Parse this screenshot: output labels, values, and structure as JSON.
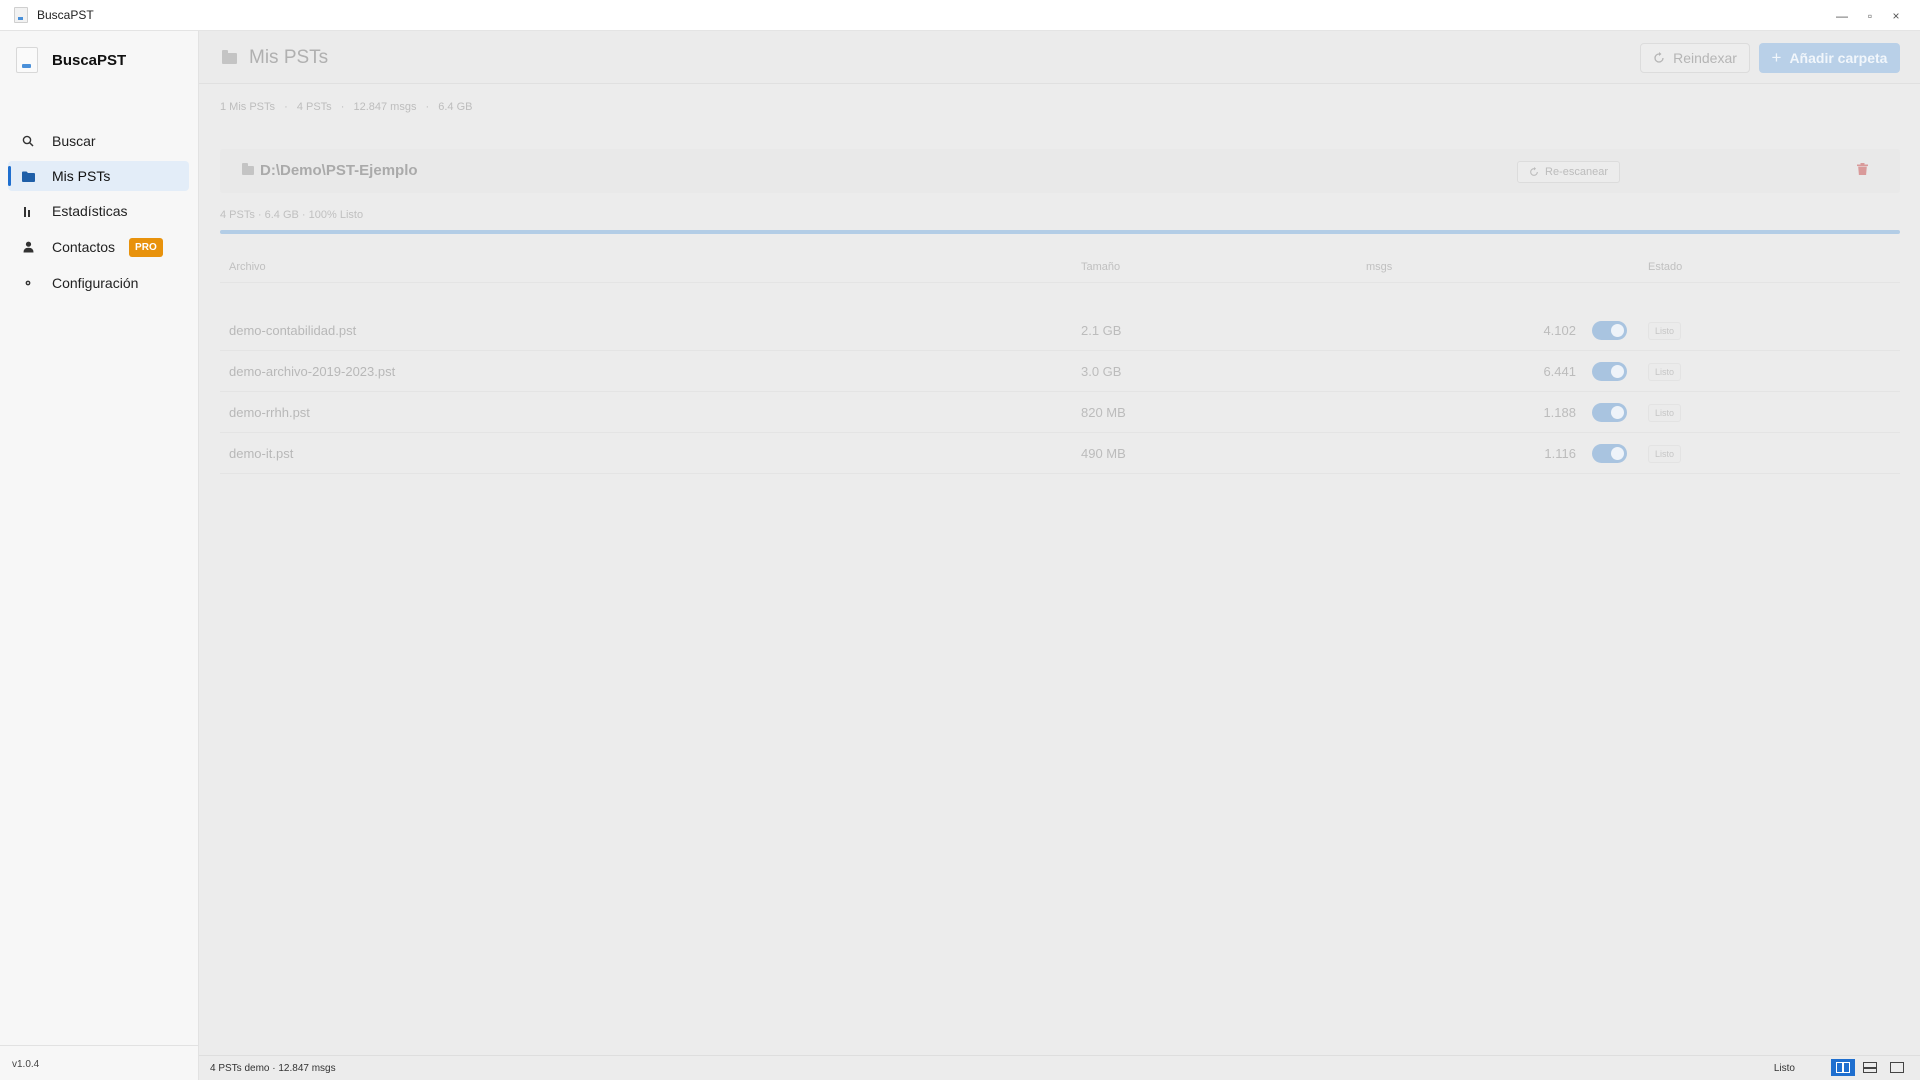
{
  "window": {
    "title": "BuscaPST",
    "controls": {
      "minimize": "—",
      "maximize": "▫",
      "close": "×"
    }
  },
  "sidebar": {
    "brand": "BuscaPST",
    "items": [
      {
        "label": "Buscar",
        "icon": "search-icon",
        "active": false
      },
      {
        "label": "Mis PSTs",
        "icon": "folder-icon",
        "active": true
      },
      {
        "label": "Estadísticas",
        "icon": "bar-chart-icon",
        "active": false
      },
      {
        "label": "Contactos",
        "icon": "person-icon",
        "active": false,
        "badge": "PRO"
      },
      {
        "label": "Configuración",
        "icon": "gear-icon",
        "active": false
      }
    ],
    "version": "v1.0.4"
  },
  "header": {
    "title": "Mis PSTs",
    "reindex_label": "Reindexar",
    "add_folder_label": "Añadir carpeta"
  },
  "summary": {
    "folders": "1 Mis PSTs",
    "psts": "4 PSTs",
    "msgs": "12.847 msgs",
    "size": "6.4 GB"
  },
  "folder": {
    "path": "D:\\Demo\\PST-Ejemplo",
    "rescan_label": "Re-escanear",
    "stats": "4 PSTs · 6.4 GB · 100% Listo",
    "progress": 1.0
  },
  "table": {
    "columns": {
      "file": "Archivo",
      "size": "Tamaño",
      "msgs": "msgs",
      "status": "Estado"
    },
    "rows": [
      {
        "file": "demo-contabilidad.pst",
        "size": "2.1 GB",
        "msgs": "4.102",
        "enabled": true,
        "status": "Listo"
      },
      {
        "file": "demo-archivo-2019-2023.pst",
        "size": "3.0 GB",
        "msgs": "6.441",
        "enabled": true,
        "status": "Listo"
      },
      {
        "file": "demo-rrhh.pst",
        "size": "820 MB",
        "msgs": "1.188",
        "enabled": true,
        "status": "Listo"
      },
      {
        "file": "demo-it.pst",
        "size": "490 MB",
        "msgs": "1.116",
        "enabled": true,
        "status": "Listo"
      }
    ]
  },
  "statusbar": {
    "left": "4 PSTs demo · 12.847 msgs",
    "right": "Listo"
  },
  "colors": {
    "accent": "#1f6fcf",
    "pro_badge": "#e8920c",
    "add_button": "#b9d0e8",
    "toggle_on": "#a9c4e0",
    "trash": "#d99a9a"
  }
}
